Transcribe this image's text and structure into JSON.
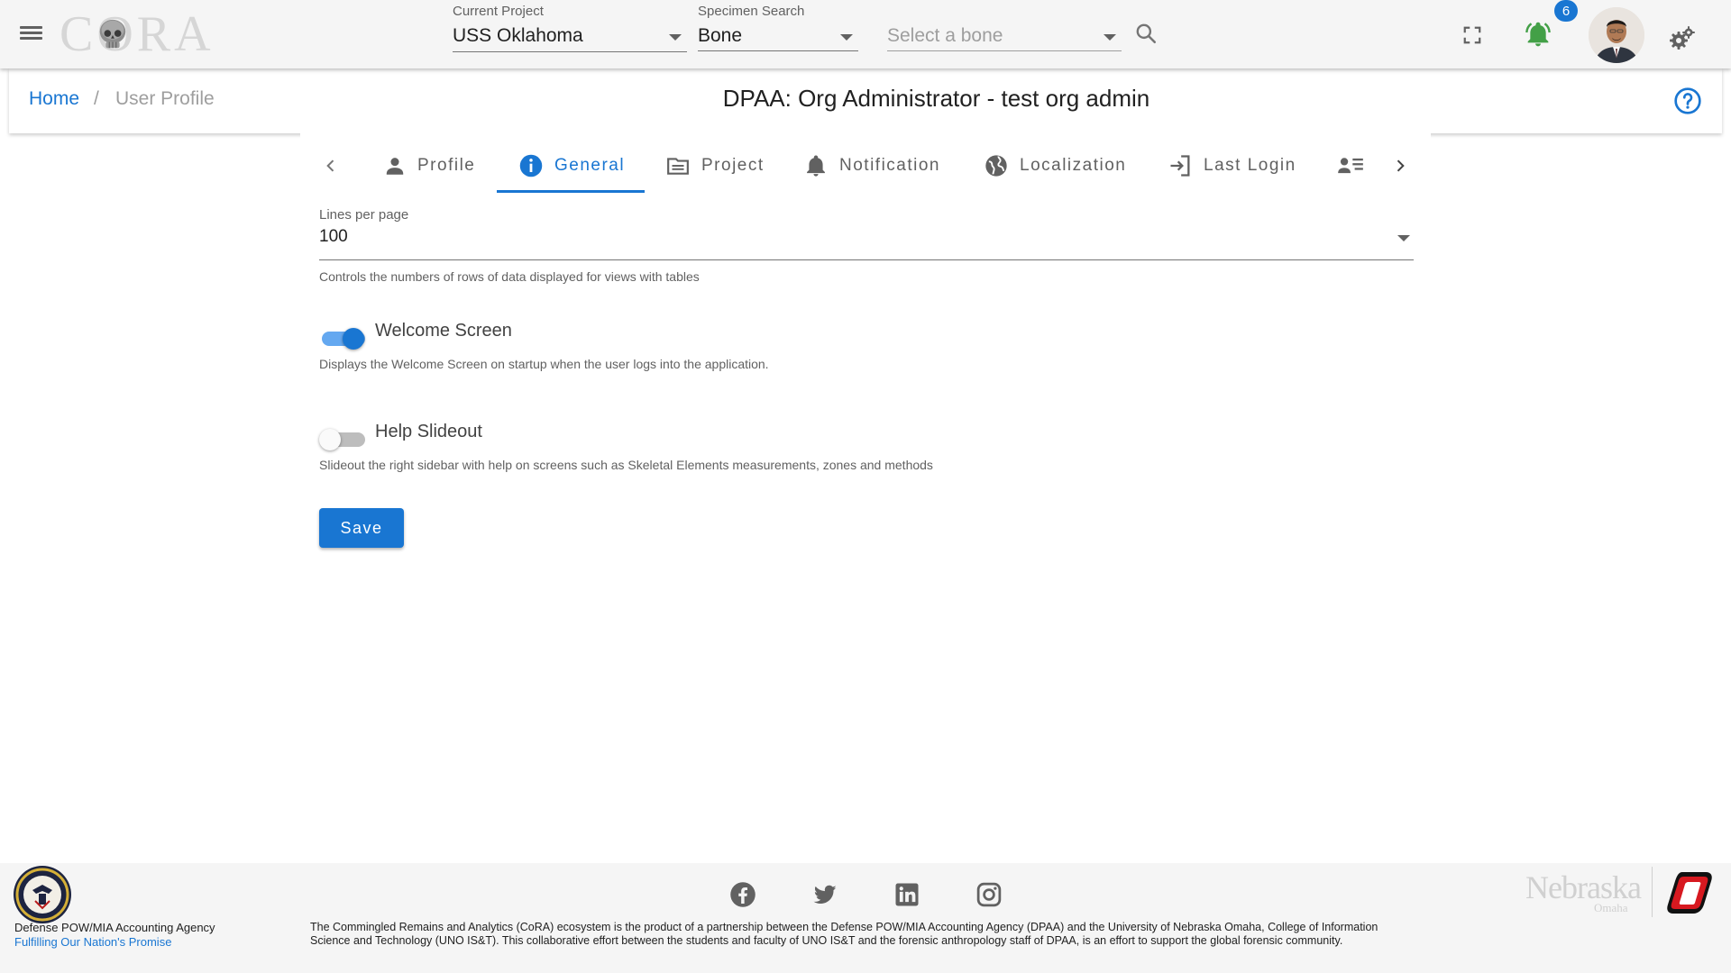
{
  "app": {
    "logo_text": "CORA"
  },
  "header": {
    "current_project": {
      "label": "Current Project",
      "value": "USS Oklahoma"
    },
    "specimen_search": {
      "label": "Specimen Search",
      "value": "Bone"
    },
    "bone_select": {
      "placeholder": "Select a bone"
    },
    "notification_count": "6"
  },
  "breadcrumb": {
    "home": "Home",
    "separator": "/",
    "current": "User Profile"
  },
  "page_title": "DPAA: Org Administrator - test org admin",
  "tabs": [
    {
      "label": "Profile",
      "icon": "person-icon"
    },
    {
      "label": "General",
      "icon": "info-icon",
      "active": true
    },
    {
      "label": "Project",
      "icon": "folder-icon"
    },
    {
      "label": "Notification",
      "icon": "bell-icon"
    },
    {
      "label": "Localization",
      "icon": "globe-icon"
    },
    {
      "label": "Last Login",
      "icon": "login-icon"
    },
    {
      "label": "",
      "icon": "contact-list-icon"
    }
  ],
  "general": {
    "lines_per_page": {
      "label": "Lines per page",
      "value": "100",
      "hint": "Controls the numbers of rows of data displayed for views with tables"
    },
    "welcome_screen": {
      "label": "Welcome Screen",
      "enabled": true,
      "hint": "Displays the Welcome Screen on startup when the user logs into the application."
    },
    "help_slideout": {
      "label": "Help Slideout",
      "enabled": false,
      "hint": "Slideout the right sidebar with help on screens such as Skeletal Elements measurements, zones and methods"
    },
    "save_label": "Save"
  },
  "footer": {
    "agency_name": "Defense POW/MIA Accounting Agency",
    "agency_motto": "Fulfilling Our Nation's Promise",
    "description": "The Commingled Remains and Analytics (CoRA) ecosystem is the product of a partnership between the Defense POW/MIA Accounting Agency (DPAA) and the University of Nebraska Omaha, College of Information Science and Technology (UNO IS&T). This collaborative effort between the students and faculty of UNO IS&T and the forensic anthropology staff of DPAA, is an effort to support the global forensic community.",
    "university_logo_text": "Nebraska",
    "university_logo_sub": "Omaha",
    "social": [
      "facebook-icon",
      "twitter-icon",
      "linkedin-icon",
      "instagram-icon"
    ]
  },
  "colors": {
    "primary": "#1976d2",
    "bell": "#43a047",
    "uno_red": "#d71920"
  }
}
